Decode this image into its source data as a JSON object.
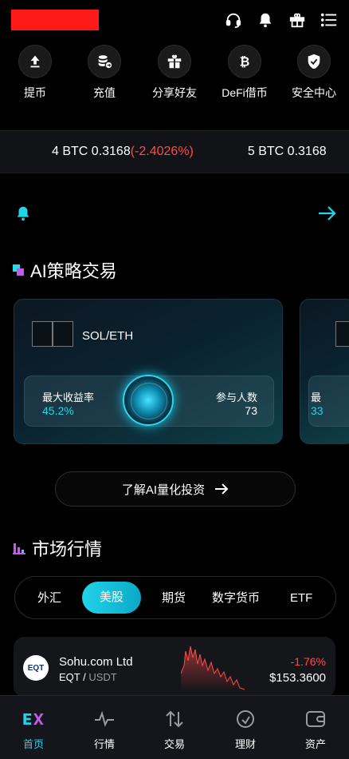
{
  "quick_actions": [
    {
      "label": "提币",
      "icon": "withdraw-icon"
    },
    {
      "label": "充值",
      "icon": "deposit-icon"
    },
    {
      "label": "分享好友",
      "icon": "gift-icon"
    },
    {
      "label": "DeFi借币",
      "icon": "bitcoin-icon"
    },
    {
      "label": "安全中心",
      "icon": "shield-icon"
    }
  ],
  "ticker": {
    "item1_main": "4 BTC 0.3168",
    "item1_change": "(-2.4026%)",
    "item2_main": "5 BTC 0.3168"
  },
  "ai_section": {
    "title": "AI策略交易",
    "card": {
      "pair": "SOL/ETH",
      "max_yield_label": "最大收益率",
      "max_yield_value": "45.2%",
      "participants_label": "参与人数",
      "participants_value": "73"
    },
    "card2": {
      "max_yield_label": "最",
      "max_yield_value": "33"
    },
    "learn_button": "了解AI量化投资"
  },
  "market_section": {
    "title": "市场行情",
    "tabs": [
      "外汇",
      "美股",
      "期货",
      "数字货币",
      "ETF"
    ],
    "active_tab": "美股",
    "rows": [
      {
        "logo_text": "EQT",
        "name": "Sohu.com Ltd",
        "symbol": "EQT",
        "quote": "USDT",
        "change": "-1.76%",
        "price": "$153.3600"
      }
    ]
  },
  "bottom_nav": [
    {
      "label": "首页",
      "icon": "home-logo-icon"
    },
    {
      "label": "行情",
      "icon": "market-pulse-icon"
    },
    {
      "label": "交易",
      "icon": "trade-arrows-icon"
    },
    {
      "label": "理财",
      "icon": "finance-icon"
    },
    {
      "label": "资产",
      "icon": "wallet-icon"
    }
  ],
  "colors": {
    "accent": "#21d4e8",
    "down": "#ff4a4a",
    "redaction": "#ff1a1a"
  }
}
